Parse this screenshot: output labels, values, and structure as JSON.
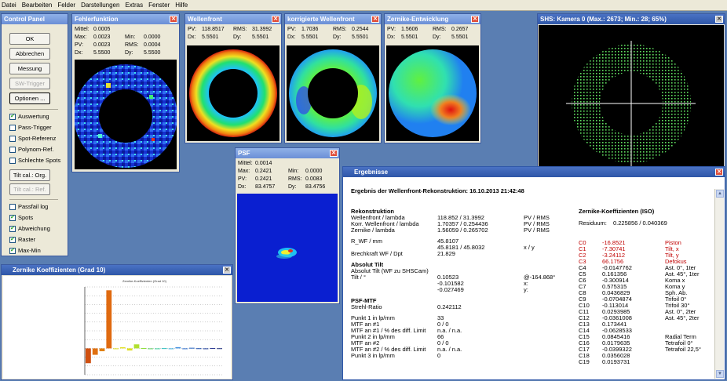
{
  "menu": [
    "Datei",
    "Bearbeiten",
    "Felder",
    "Darstellungen",
    "Extras",
    "Fenster",
    "Hilfe"
  ],
  "control_panel": {
    "title": "Control Panel",
    "buttons": [
      {
        "label": "OK",
        "enabled": true
      },
      {
        "label": "Abbrechen",
        "enabled": true
      },
      {
        "label": "Messung",
        "enabled": true
      },
      {
        "label": "SW-Trigger",
        "enabled": false
      },
      {
        "label": "Optionen ...",
        "enabled": true
      }
    ],
    "checks1": [
      {
        "label": "Auswertung",
        "checked": true
      },
      {
        "label": "Pass-Trigger",
        "checked": false
      },
      {
        "label": "Spot-Referenz",
        "checked": false
      },
      {
        "label": "Polynom-Ref.",
        "checked": false
      },
      {
        "label": "Schlechte Spots",
        "checked": false
      }
    ],
    "tilt_buttons": [
      {
        "label": "Tilt cal.: Org.",
        "enabled": true
      },
      {
        "label": "Tilt cal.: Ref.",
        "enabled": false
      }
    ],
    "checks2": [
      {
        "label": "Passfail log",
        "checked": false
      },
      {
        "label": "Spots",
        "checked": true
      },
      {
        "label": "Abweichung",
        "checked": true
      },
      {
        "label": "Raster",
        "checked": true
      },
      {
        "label": "Max-Min",
        "checked": true
      }
    ]
  },
  "fehler": {
    "title": "Fehlerfunktion",
    "rows": [
      [
        "Mittel:",
        "0.0005",
        "",
        ""
      ],
      [
        "Max:",
        "0.0023",
        "Min:",
        "0.0000"
      ],
      [
        "PV:",
        "0.0023",
        "RMS:",
        "0.0004"
      ],
      [
        "Dx:",
        "5.5500",
        "Dy:",
        "5.5500"
      ]
    ]
  },
  "wellen": {
    "title": "Wellenfront",
    "rows": [
      [
        "PV:",
        "118.8517",
        "RMS:",
        "31.3992"
      ],
      [
        "Dx:",
        "5.5501",
        "Dy:",
        "5.5501"
      ]
    ]
  },
  "korr": {
    "title": "korrigierte Wellenfront",
    "rows": [
      [
        "PV:",
        "1.7036",
        "RMS:",
        "0.2544"
      ],
      [
        "Dx:",
        "5.5501",
        "Dy:",
        "5.5501"
      ]
    ]
  },
  "zern_ent": {
    "title": "Zernike-Entwicklung",
    "rows": [
      [
        "PV:",
        "1.5606",
        "RMS:",
        "0.2657"
      ],
      [
        "Dx:",
        "5.5501",
        "Dy:",
        "5.5501"
      ]
    ]
  },
  "kamera": {
    "title": "SHS: Kamera 0  (Max.:    2673;  Min.:       28;    65%)"
  },
  "psf": {
    "title": "PSF",
    "rows": [
      [
        "Mittel:",
        "0.0014",
        "",
        ""
      ],
      [
        "Max:",
        "0.2421",
        "Min:",
        "0.0000"
      ],
      [
        "PV:",
        "0.2421",
        "RMS:",
        "0.0083"
      ],
      [
        "Dx:",
        "83.4757",
        "Dy:",
        "83.4756"
      ]
    ]
  },
  "zk_graph": {
    "title": "Zernike Koeffizienten (Grad 10)",
    "chart_title": "Zernike-Koeffizienten (Grad 10)"
  },
  "ergebnisse": {
    "title": "Ergebnisse",
    "header": "Ergebnis der Wellenfront-Rekonstruktion:  16.10.2013   21:42:48",
    "sec_rekon": "Rekonstruktion",
    "rekon": [
      [
        "Wellenfront / lambda",
        "118.852 / 31.3992",
        "PV / RMS"
      ],
      [
        "Korr. Wellenfront / lambda",
        "1.70357 / 0.254436",
        "PV / RMS"
      ],
      [
        "Zernike / lambda",
        "1.56059 / 0.265702",
        "PV / RMS"
      ]
    ],
    "rwf_label": "R_WF / mm",
    "rwf_v1": "45.8107",
    "rwf_v2": "45.8181 / 45.8032",
    "rwf_unit": "x / y",
    "brech_label": "Brechkraft WF / Dpt",
    "brech_val": "21.829",
    "sec_tilt": "Absolut Tilt",
    "tilt_sub": "Absolut Tilt (WF zu SHSCam)",
    "tilt_label": "Tilt / °",
    "tilt_vals": [
      "0.10523",
      "-0.101582",
      "-0.027469"
    ],
    "tilt_unit": [
      "@-164.868°",
      "x:",
      "y:"
    ],
    "sec_psf": "PSF-MTF",
    "strehl_label": "Strehl-Ratio",
    "strehl_val": "0.242112",
    "mtf": [
      [
        "Punkt 1 in lp/mm",
        "33"
      ],
      [
        "MTF an #1",
        "0 / 0"
      ],
      [
        "MTF an #1 / % des diff. Limit",
        "n.a. / n.a."
      ],
      [
        "Punkt 2 in lp/mm",
        "66"
      ],
      [
        "MTF an #2",
        "0 / 0"
      ],
      [
        "MTF an #2 / % des diff. Limit",
        "n.a. / n.a."
      ],
      [
        "Punkt 3 in lp/mm",
        "0"
      ]
    ],
    "zk_head": "Zernike-Koeffizienten (ISO)",
    "resid_label": "Residuum:",
    "resid_val": "0.225856 / 0.040369",
    "zk": [
      [
        "C0",
        "-16.8521",
        "Piston",
        true
      ],
      [
        "C1",
        "-7.30741",
        "Tilt, x",
        true
      ],
      [
        "C2",
        "-3.24112",
        "Tilt, y",
        true
      ],
      [
        "C3",
        "66.1756",
        "Defokus",
        true
      ],
      [
        "C4",
        "-0.0147762",
        "Ast. 0°, 1ter",
        false
      ],
      [
        "C5",
        "0.161356",
        "Ast. 45°, 1ter",
        false
      ],
      [
        "C6",
        "-0.300914",
        "Koma x",
        false
      ],
      [
        "C7",
        "0.575315",
        "Koma y",
        false
      ],
      [
        "C8",
        "0.0436829",
        "Sph. Ab.",
        false
      ],
      [
        "C9",
        "-0.0704874",
        "Trifoil 0°",
        false
      ],
      [
        "C10",
        "-0.113014",
        "Trifoil 30°",
        false
      ],
      [
        "C11",
        "0.0293985",
        "Ast. 0°, 2ter",
        false
      ],
      [
        "C12",
        "-0.0361008",
        "Ast. 45°, 2ter",
        false
      ],
      [
        "C13",
        "0.173441",
        "",
        false
      ],
      [
        "C14",
        "-0.0628533",
        "",
        false
      ],
      [
        "C15",
        "0.0845416",
        "Radial Term",
        false
      ],
      [
        "C16",
        "0.0179635",
        "Tetrafoil 0°",
        false
      ],
      [
        "C17",
        "-0.0399322",
        "Tetrafoil 22,5°",
        false
      ],
      [
        "C18",
        "0.0356028",
        "",
        false
      ],
      [
        "C19",
        "0.0193731",
        "",
        false
      ]
    ]
  },
  "chart_data": {
    "type": "bar",
    "title": "Zernike-Koeffizienten (Grad 10)",
    "categories": [
      "C0",
      "C1",
      "C2",
      "C3",
      "C4",
      "C5",
      "C6",
      "C7",
      "C8",
      "C9",
      "C10",
      "C11",
      "C12",
      "C13",
      "C14",
      "C15",
      "C16",
      "C17",
      "C18",
      "C19"
    ],
    "values": [
      -16.8521,
      -7.30741,
      -3.24112,
      66.1756,
      -0.0147762,
      0.161356,
      -0.300914,
      0.575315,
      0.0436829,
      -0.0704874,
      -0.113014,
      0.0293985,
      -0.0361008,
      0.173441,
      -0.0628533,
      0.0845416,
      0.0179635,
      -0.0399322,
      0.0356028,
      0.0193731
    ]
  }
}
